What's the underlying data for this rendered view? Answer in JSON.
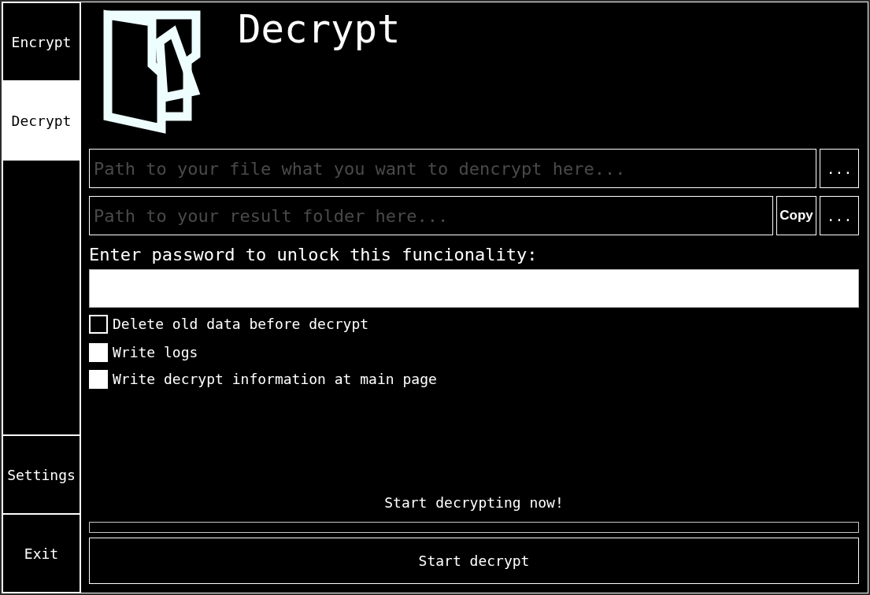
{
  "sidebar": {
    "top_items": [
      {
        "label": "Encrypt",
        "selected": false
      },
      {
        "label": "Decrypt",
        "selected": true
      }
    ],
    "bottom_items": [
      {
        "label": "Settings",
        "selected": false
      },
      {
        "label": "Exit",
        "selected": false
      }
    ]
  },
  "header": {
    "title": "Decrypt"
  },
  "file_path": {
    "placeholder": "Path to your file what you want to dencrypt here...",
    "browse_button": "..."
  },
  "result_folder": {
    "placeholder": "Path to your result folder here...",
    "copy_button": "Copy",
    "browse_button": "..."
  },
  "password": {
    "label": "Enter password to unlock this funcionality:"
  },
  "options": [
    {
      "kind": "outlined",
      "label": "Delete old data before decrypt",
      "checked": false
    },
    {
      "kind": "solid",
      "label": "Write logs",
      "checked": false
    },
    {
      "kind": "solid",
      "label": "Write decrypt information at main page",
      "checked": false
    }
  ],
  "status": "Start decrypting now!",
  "progress": {
    "level": 0
  },
  "start_button": "Start decrypt"
}
